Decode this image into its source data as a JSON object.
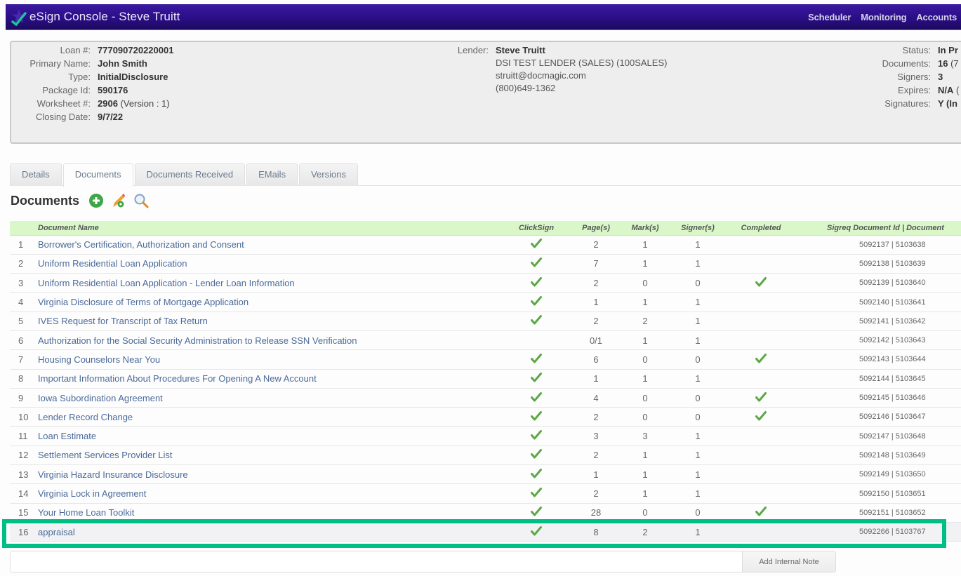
{
  "window": {
    "title": "eSign Console - Steve Truitt",
    "logo_icon": "esign-checkmark-logo"
  },
  "topnav": {
    "items": [
      "Scheduler",
      "Monitoring",
      "Accounts"
    ]
  },
  "loan_info": {
    "left": [
      {
        "label": "Loan #:",
        "value": "777090720220001",
        "bold": true
      },
      {
        "label": "Primary Name:",
        "value": "John Smith",
        "bold": true
      },
      {
        "label": "Type:",
        "value": "InitialDisclosure",
        "bold": true
      },
      {
        "label": "Package Id:",
        "value": "590176",
        "bold": true
      },
      {
        "label": "Worksheet #:",
        "value": "2906",
        "suffix": " (Version : 1)",
        "bold": true
      },
      {
        "label": "Closing Date:",
        "value": "9/7/22",
        "bold": true
      }
    ],
    "lender": {
      "label": "Lender:",
      "name": "Steve Truitt",
      "company": "DSI TEST LENDER (SALES) (100SALES)",
      "email": "struitt@docmagic.com",
      "phone": "(800)649-1362"
    },
    "right": [
      {
        "label": "Status:",
        "value": "In Pr"
      },
      {
        "label": "Documents:",
        "value": "16",
        "suffix": " (7"
      },
      {
        "label": "Signers:",
        "value": "3"
      },
      {
        "label": "Expires:",
        "value": "N/A",
        "suffix": " ("
      },
      {
        "label": "Signatures:",
        "value": "Y (In"
      }
    ]
  },
  "tabs": [
    {
      "label": "Details",
      "active": false
    },
    {
      "label": "Documents",
      "active": true
    },
    {
      "label": "Documents Received",
      "active": false
    },
    {
      "label": "EMails",
      "active": false
    },
    {
      "label": "Versions",
      "active": false
    }
  ],
  "section": {
    "title": "Documents",
    "icons": [
      "add-icon",
      "edit-pencil-icon",
      "search-icon"
    ]
  },
  "table": {
    "columns": [
      "",
      "Document Name",
      "ClickSign",
      "Page(s)",
      "Mark(s)",
      "Signer(s)",
      "Completed",
      "Sigreq Document Id | Document"
    ],
    "rows": [
      {
        "num": "1",
        "name": "Borrower's Certification, Authorization and Consent",
        "clicksign": true,
        "pages": "2",
        "marks": "1",
        "signers": "1",
        "completed": false,
        "ids": "5092137 | 5103638"
      },
      {
        "num": "2",
        "name": "Uniform Residential Loan Application",
        "clicksign": true,
        "pages": "7",
        "marks": "1",
        "signers": "1",
        "completed": false,
        "ids": "5092138 | 5103639"
      },
      {
        "num": "3",
        "name": "Uniform Residential Loan Application - Lender Loan Information",
        "clicksign": true,
        "pages": "2",
        "marks": "0",
        "signers": "0",
        "completed": true,
        "ids": "5092139 | 5103640"
      },
      {
        "num": "4",
        "name": "Virginia Disclosure of Terms of Mortgage Application",
        "clicksign": true,
        "pages": "1",
        "marks": "1",
        "signers": "1",
        "completed": false,
        "ids": "5092140 | 5103641"
      },
      {
        "num": "5",
        "name": "IVES Request for Transcript of Tax Return",
        "clicksign": true,
        "pages": "2",
        "marks": "2",
        "signers": "1",
        "completed": false,
        "ids": "5092141 | 5103642"
      },
      {
        "num": "6",
        "name": "Authorization for the Social Security Administration to Release SSN Verification",
        "clicksign": false,
        "pages": "0/1",
        "marks": "1",
        "signers": "1",
        "completed": false,
        "ids": "5092142 | 5103643"
      },
      {
        "num": "7",
        "name": "Housing Counselors Near You",
        "clicksign": true,
        "pages": "6",
        "marks": "0",
        "signers": "0",
        "completed": true,
        "ids": "5092143 | 5103644"
      },
      {
        "num": "8",
        "name": "Important Information About Procedures For Opening A New Account",
        "clicksign": true,
        "pages": "1",
        "marks": "1",
        "signers": "1",
        "completed": false,
        "ids": "5092144 | 5103645"
      },
      {
        "num": "9",
        "name": "Iowa Subordination Agreement",
        "clicksign": true,
        "pages": "4",
        "marks": "0",
        "signers": "0",
        "completed": true,
        "ids": "5092145 | 5103646"
      },
      {
        "num": "10",
        "name": "Lender Record Change",
        "clicksign": true,
        "pages": "2",
        "marks": "0",
        "signers": "0",
        "completed": true,
        "ids": "5092146 | 5103647"
      },
      {
        "num": "11",
        "name": "Loan Estimate",
        "clicksign": true,
        "pages": "3",
        "marks": "3",
        "signers": "1",
        "completed": false,
        "ids": "5092147 | 5103648"
      },
      {
        "num": "12",
        "name": "Settlement Services Provider List",
        "clicksign": true,
        "pages": "2",
        "marks": "1",
        "signers": "1",
        "completed": false,
        "ids": "5092148 | 5103649"
      },
      {
        "num": "13",
        "name": "Virginia Hazard Insurance Disclosure",
        "clicksign": true,
        "pages": "1",
        "marks": "1",
        "signers": "1",
        "completed": false,
        "ids": "5092149 | 5103650"
      },
      {
        "num": "14",
        "name": "Virginia Lock in Agreement",
        "clicksign": true,
        "pages": "2",
        "marks": "1",
        "signers": "1",
        "completed": false,
        "ids": "5092150 | 5103651"
      },
      {
        "num": "15",
        "name": "Your Home Loan Toolkit",
        "clicksign": true,
        "pages": "28",
        "marks": "0",
        "signers": "0",
        "completed": true,
        "ids": "5092151 | 5103652"
      },
      {
        "num": "16",
        "name": "appraisal",
        "clicksign": true,
        "pages": "8",
        "marks": "2",
        "signers": "1",
        "completed": false,
        "ids": "5092266 | 5103767",
        "highlighted": true
      }
    ]
  },
  "note": {
    "value": "",
    "placeholder": "",
    "button_label": "Add Internal Note"
  },
  "colors": {
    "titlebar": "#2a0e86",
    "header_row": "#d9f7c9",
    "link": "#4a6a9a",
    "check": "#5aa845",
    "highlight_frame": "#00bf86"
  }
}
